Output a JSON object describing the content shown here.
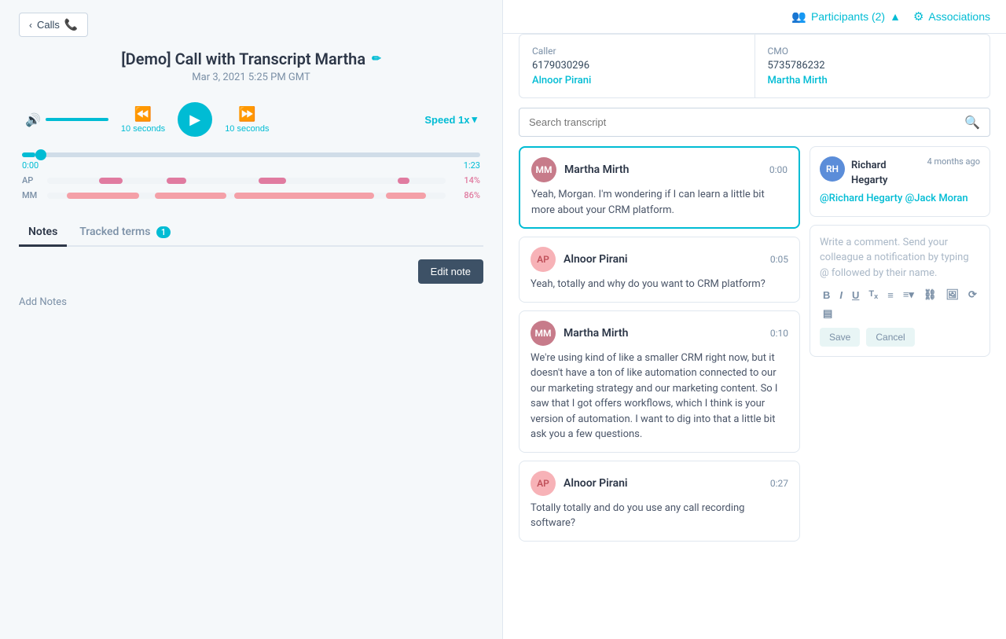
{
  "left": {
    "back_btn": "Calls",
    "title": "[Demo] Call with Transcript Martha",
    "date": "Mar 3, 2021 5:25 PM GMT",
    "skip_back_label": "10 seconds",
    "skip_forward_label": "10 seconds",
    "speed_label": "Speed 1x",
    "timeline": {
      "start": "0:00",
      "end": "1:23"
    },
    "speakers": [
      {
        "label": "AP",
        "pct": "14%",
        "bars": [
          {
            "left": "13%",
            "width": "6%"
          },
          {
            "left": "30%",
            "width": "5%"
          },
          {
            "left": "53%",
            "width": "7%"
          },
          {
            "left": "88%",
            "width": "3%"
          }
        ]
      },
      {
        "label": "MM",
        "pct": "86%",
        "bars": [
          {
            "left": "5%",
            "width": "18%"
          },
          {
            "left": "27%",
            "width": "18%"
          },
          {
            "left": "47%",
            "width": "35%"
          },
          {
            "left": "85%",
            "width": "10%"
          }
        ]
      }
    ],
    "tabs": [
      {
        "label": "Notes",
        "active": true,
        "badge": null
      },
      {
        "label": "Tracked terms",
        "active": false,
        "badge": "1"
      }
    ],
    "edit_note_label": "Edit note",
    "add_notes_label": "Add Notes"
  },
  "right": {
    "participants_label": "Participants (2)",
    "associations_label": "Associations",
    "caller_role": "Caller",
    "caller_phone": "6179030296",
    "caller_name": "Alnoor Pirani",
    "cmo_role": "CMO",
    "cmo_phone": "5735786232",
    "cmo_name": "Martha Mirth",
    "search_placeholder": "Search transcript",
    "transcript": [
      {
        "speaker": "Martha Mirth",
        "initials": "MM",
        "avatar_color": "#c77b8a",
        "time": "0:00",
        "text": "Yeah, Morgan. I'm wondering if I can learn a little bit more about your CRM platform.",
        "highlighted": true
      },
      {
        "speaker": "Alnoor Pirani",
        "initials": "AP",
        "avatar_color": "#f7b2b7",
        "time": "0:05",
        "text": "Yeah, totally and why do you want to CRM platform?",
        "highlighted": false
      },
      {
        "speaker": "Martha Mirth",
        "initials": "MM",
        "avatar_color": "#c77b8a",
        "time": "0:10",
        "text": "We're using kind of like a smaller CRM right now, but it doesn't have a ton of like automation connected to our our marketing strategy and our marketing content. So I saw that I got offers workflows, which I think is your version of automation. I want to dig into that a little bit ask you a few questions.",
        "highlighted": false
      },
      {
        "speaker": "Alnoor Pirani",
        "initials": "AP",
        "avatar_color": "#f7b2b7",
        "time": "0:27",
        "text": "Totally totally and do you use any call recording software?",
        "highlighted": false
      }
    ],
    "comment": {
      "author": "Richard Hegarty",
      "time": "4 months ago",
      "text": "@Richard Hegarty @Jack Moran",
      "initials": "RH",
      "avatar_color": "#5b8dd9"
    },
    "write_comment_placeholder": "Write a comment. Send your colleague a notification by typing @ followed by their name.",
    "toolbar_buttons": [
      "B",
      "I",
      "U",
      "Tx",
      "≡",
      "⬡",
      "⬞",
      "⟲",
      "▤"
    ],
    "save_label": "Save",
    "cancel_label": "Cancel"
  }
}
